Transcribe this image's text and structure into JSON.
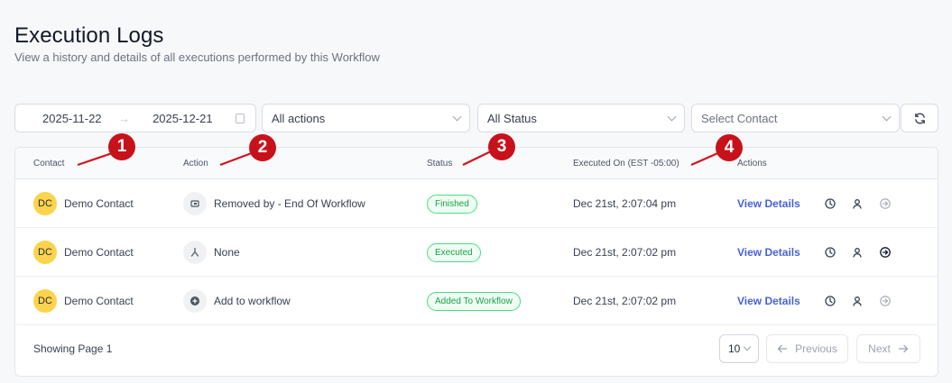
{
  "header": {
    "title": "Execution Logs",
    "subtitle": "View a history and details of all executions performed by this Workflow"
  },
  "filters": {
    "date_start": "2025-11-22",
    "date_arrow": "→",
    "date_end": "2025-12-21",
    "actions_value": "All actions",
    "status_value": "All Status",
    "contact_placeholder": "Select Contact"
  },
  "table": {
    "columns": [
      "Contact",
      "Action",
      "Status",
      "Executed On (EST -05:00)",
      "Actions"
    ],
    "rows": [
      {
        "initials": "DC",
        "contact": "Demo Contact",
        "action": "Removed by - End Of Workflow",
        "action_icon": "remove-workflow-icon",
        "status": "Finished",
        "executed_on": "Dec 21st, 2:07:04 pm",
        "link": "View Details"
      },
      {
        "initials": "DC",
        "contact": "Demo Contact",
        "action": "None",
        "action_icon": "branch-icon",
        "status": "Executed",
        "executed_on": "Dec 21st, 2:07:02 pm",
        "link": "View Details"
      },
      {
        "initials": "DC",
        "contact": "Demo Contact",
        "action": "Add to workflow",
        "action_icon": "plus-circle-icon",
        "status": "Added To Workflow",
        "executed_on": "Dec 21st, 2:07:02 pm",
        "link": "View Details"
      }
    ]
  },
  "footer": {
    "showing": "Showing Page 1",
    "page_size": "10",
    "previous": "Previous",
    "next": "Next"
  },
  "annotations": [
    "1",
    "2",
    "3",
    "4"
  ],
  "colors": {
    "accent": "#4763d6",
    "success": "#16a34a",
    "avatar": "#fcd34d",
    "marker": "#c8121b"
  }
}
